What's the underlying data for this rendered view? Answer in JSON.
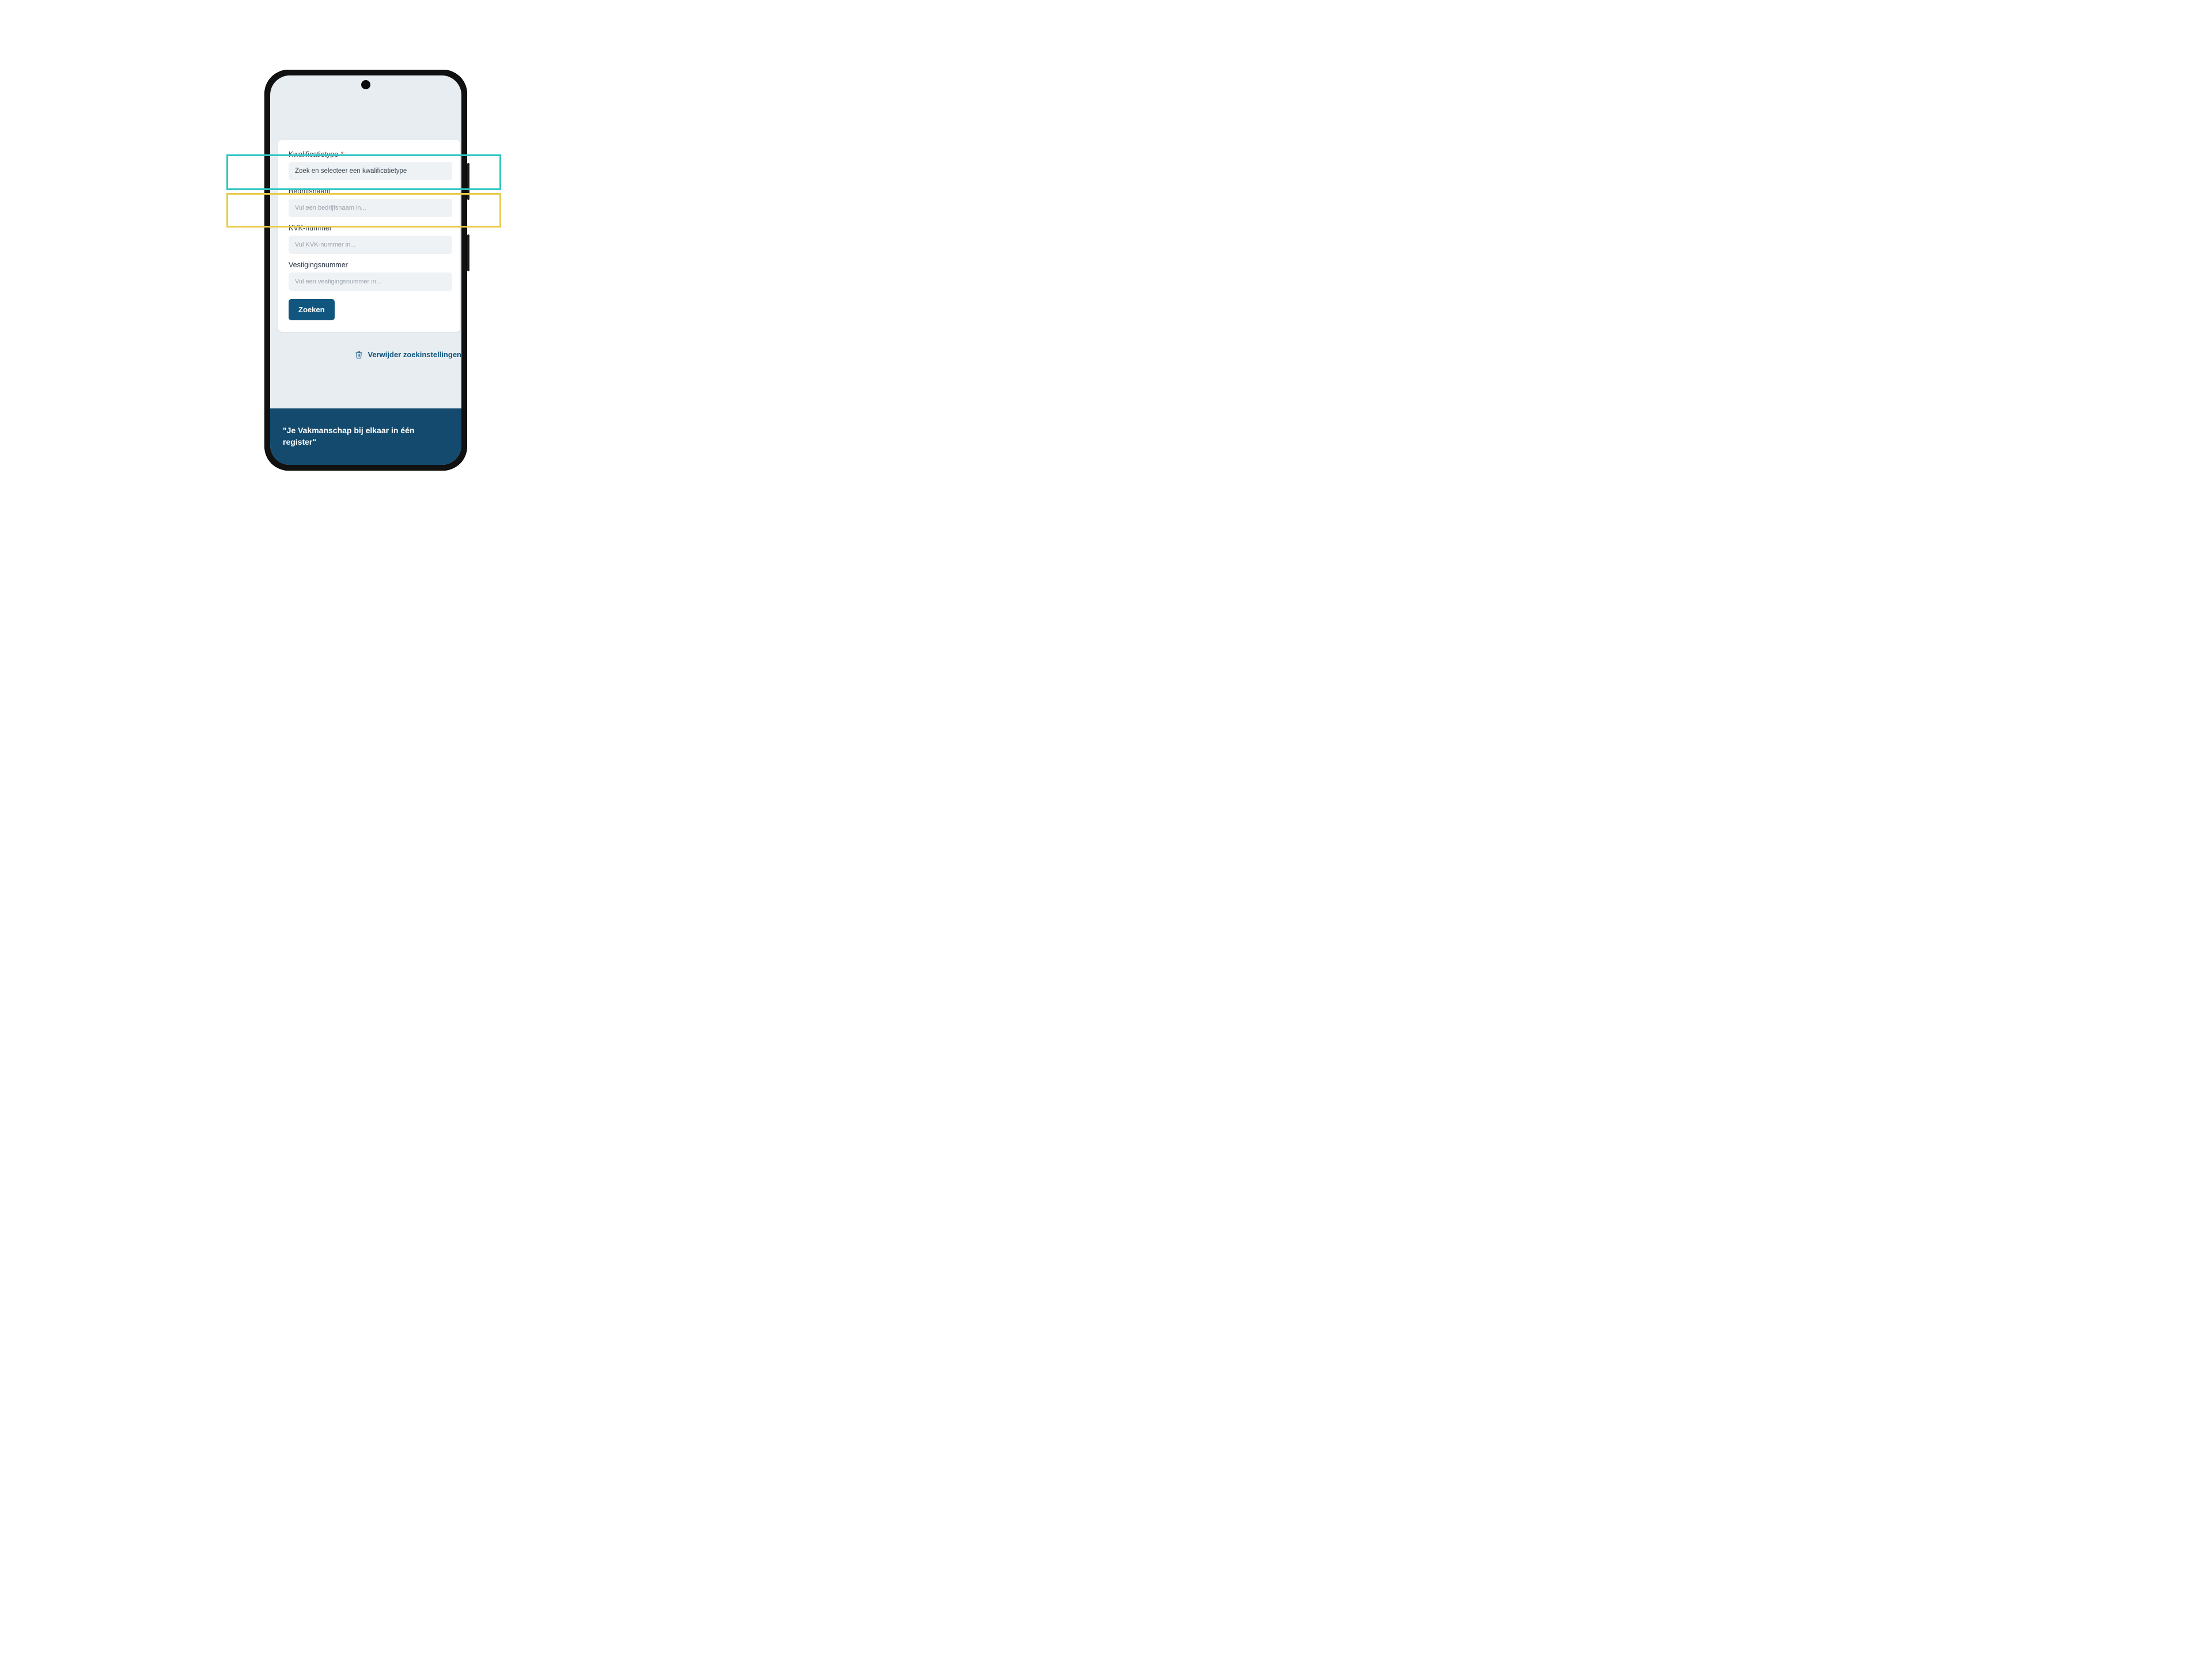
{
  "form": {
    "kwalificatietype": {
      "label": "Kwalificatietype",
      "required_marker": "*",
      "placeholder": "Zoek en selecteer een kwalificatietype"
    },
    "bedrijfsnaam": {
      "label": "Bedrijfsnaam",
      "placeholder": "Vul een bedrijfsnaam in..."
    },
    "kvk": {
      "label": "KVK-nummer",
      "placeholder": "Vul KVK-nummer in..."
    },
    "vestiging": {
      "label": "Vestigingsnummer",
      "placeholder": "Vul een vestigingsnummer in..."
    },
    "submit_label": "Zoeken",
    "reset_label": "Verwijder zoekinstellingen"
  },
  "footer": {
    "quote": "\"Je Vakmanschap bij elkaar in één register\""
  }
}
